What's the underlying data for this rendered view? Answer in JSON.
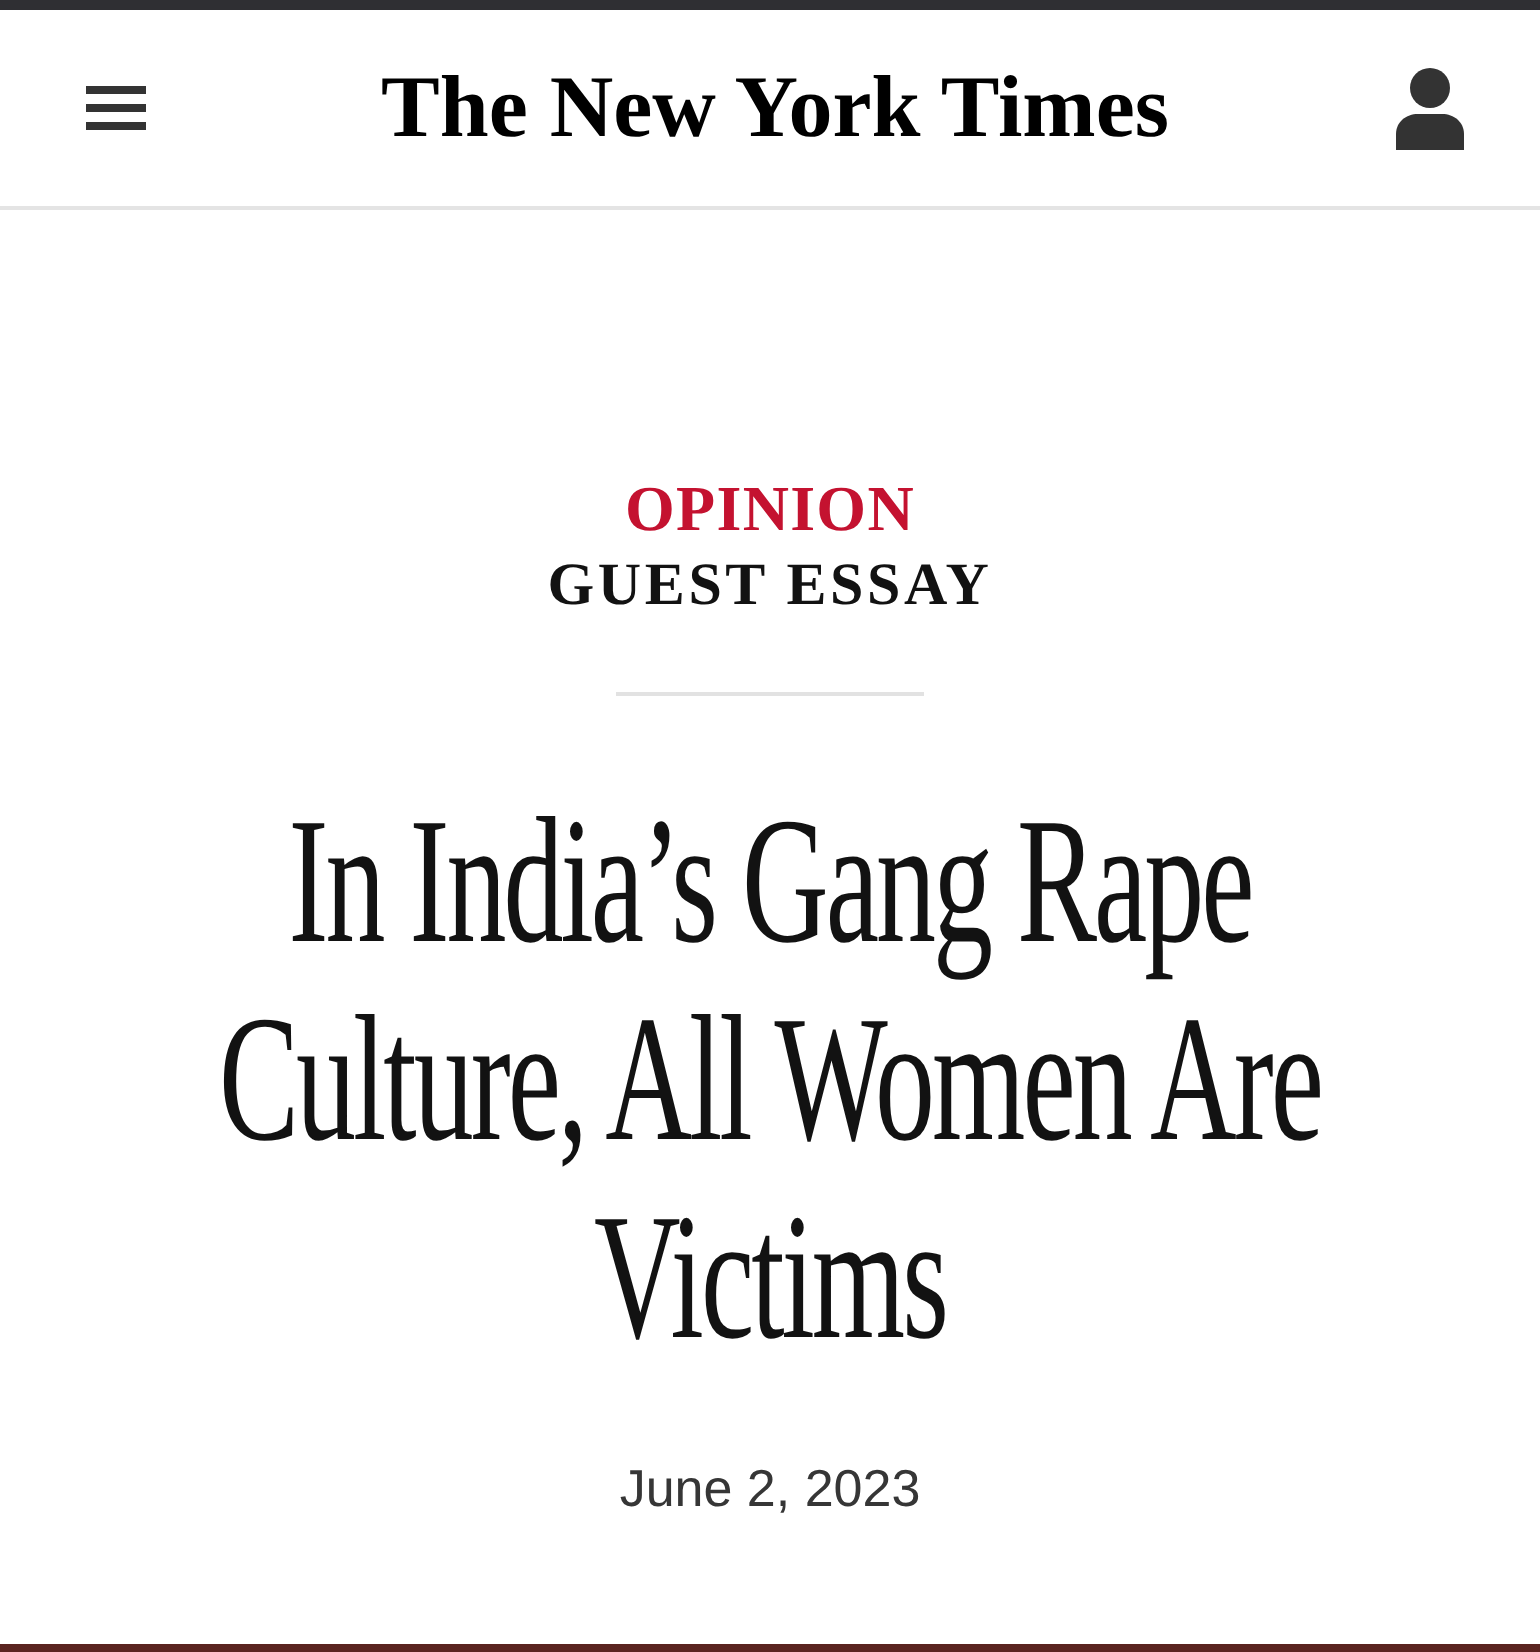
{
  "header": {
    "logo": "The New York Times"
  },
  "article": {
    "section": "OPINION",
    "label": "GUEST ESSAY",
    "headline": "In India’s Gang Rape Culture, All Women Are Victims",
    "date": "June 2, 2023"
  }
}
